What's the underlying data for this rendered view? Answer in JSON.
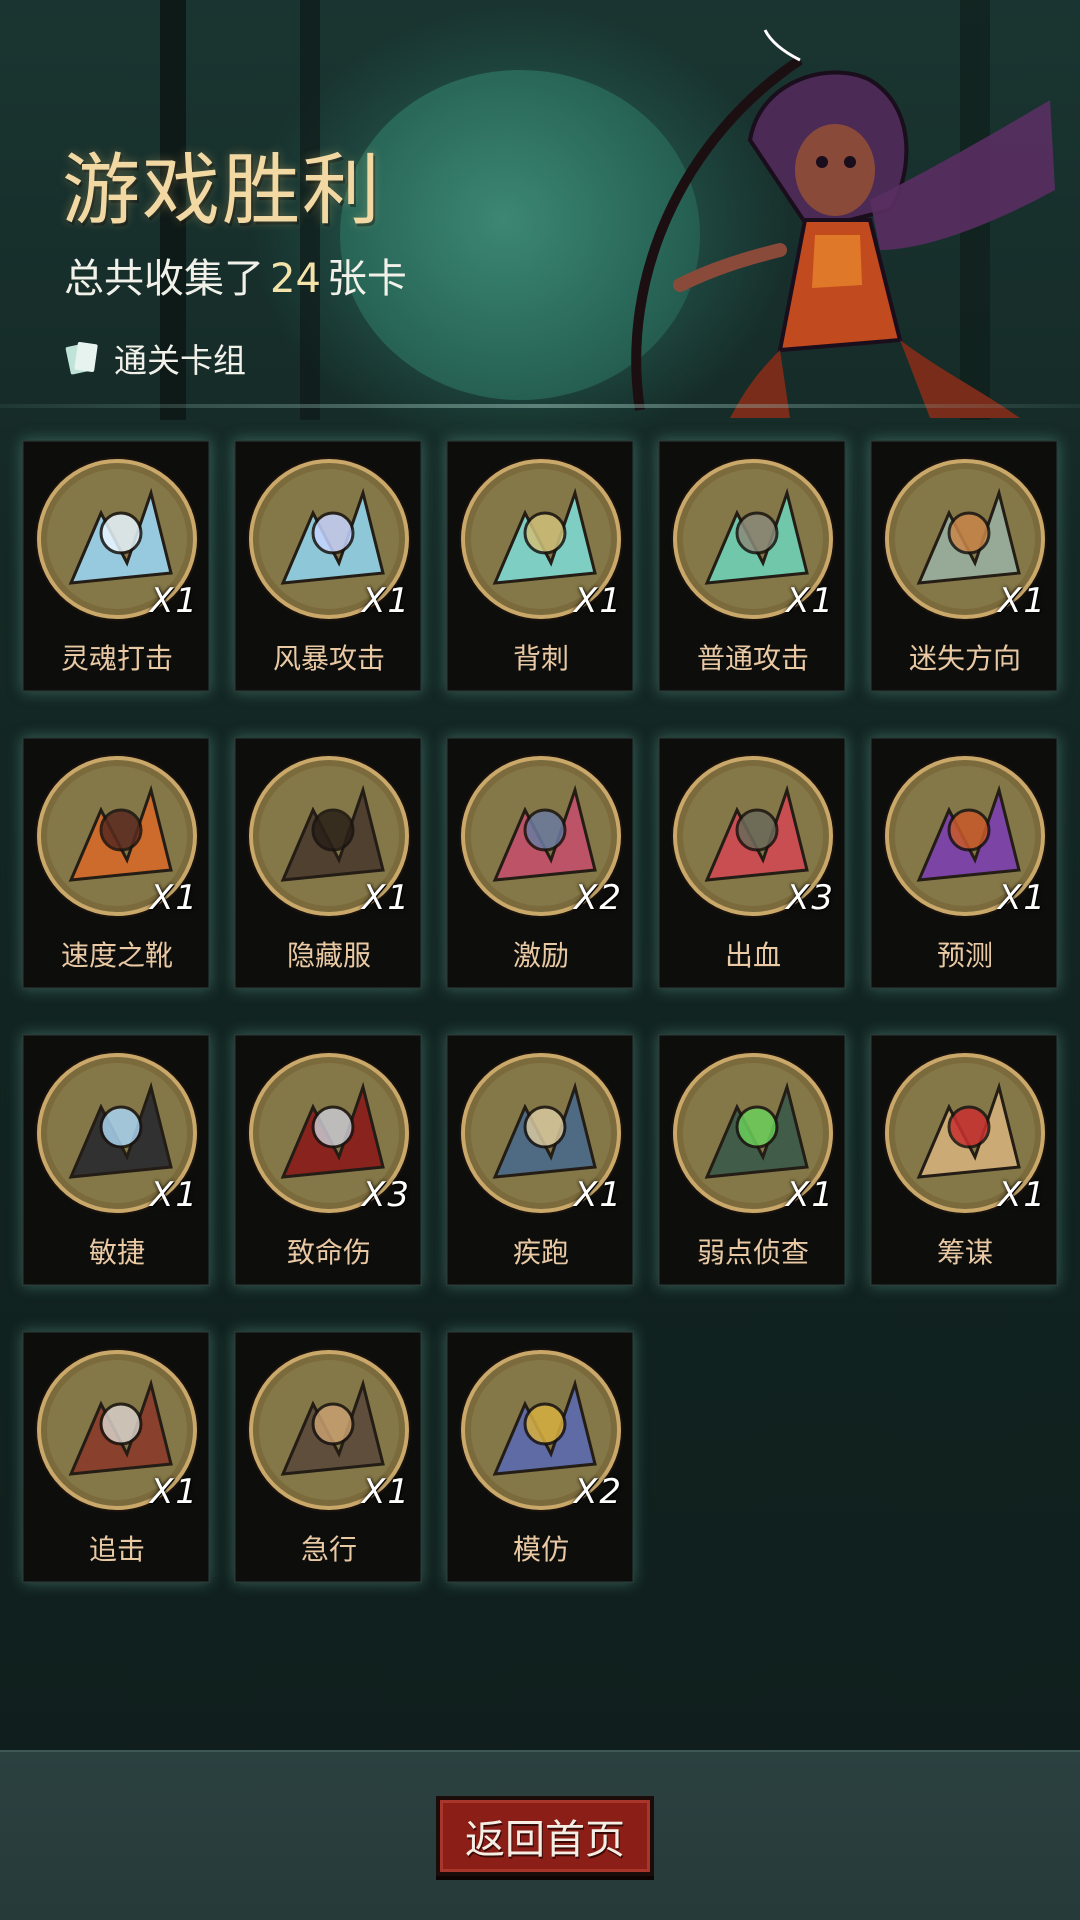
{
  "header": {
    "title": "游戏胜利",
    "summary_prefix": "总共收集了",
    "summary_count": "24",
    "summary_suffix": "张卡",
    "deck_link_label": "通关卡组"
  },
  "cards": [
    {
      "name": "灵魂打击",
      "qty": "X1",
      "icon": "ice-spikes-icon"
    },
    {
      "name": "风暴攻击",
      "qty": "X1",
      "icon": "lightning-icon"
    },
    {
      "name": "背刺",
      "qty": "X1",
      "icon": "backstab-figure-icon"
    },
    {
      "name": "普通攻击",
      "qty": "X1",
      "icon": "spear-thrust-icon"
    },
    {
      "name": "迷失方向",
      "qty": "X1",
      "icon": "signpost-icon"
    },
    {
      "name": "速度之靴",
      "qty": "X1",
      "icon": "boot-icon"
    },
    {
      "name": "隐藏服",
      "qty": "X1",
      "icon": "hooded-cloak-icon"
    },
    {
      "name": "激励",
      "qty": "X2",
      "icon": "hammer-warrior-icon"
    },
    {
      "name": "出血",
      "qty": "X3",
      "icon": "tentacle-monster-icon"
    },
    {
      "name": "预测",
      "qty": "X1",
      "icon": "witch-icon"
    },
    {
      "name": "敏捷",
      "qty": "X1",
      "icon": "panther-icon"
    },
    {
      "name": "致命伤",
      "qty": "X3",
      "icon": "bloody-dagger-icon"
    },
    {
      "name": "疾跑",
      "qty": "X1",
      "icon": "running-wolfman-icon"
    },
    {
      "name": "弱点侦查",
      "qty": "X1",
      "icon": "wolf-head-icon"
    },
    {
      "name": "筹谋",
      "qty": "X1",
      "icon": "battle-map-icon"
    },
    {
      "name": "追击",
      "qty": "X1",
      "icon": "pursuer-icon"
    },
    {
      "name": "急行",
      "qty": "X1",
      "icon": "dashing-warrior-icon"
    },
    {
      "name": "模仿",
      "qty": "X2",
      "icon": "goblin-mask-icon"
    }
  ],
  "footer": {
    "home_button_label": "返回首页"
  },
  "colors": {
    "title": "#f2d9a4",
    "card_name": "#e9c9a4",
    "button": "#8b1e17",
    "card_glow": "#82d2be"
  }
}
